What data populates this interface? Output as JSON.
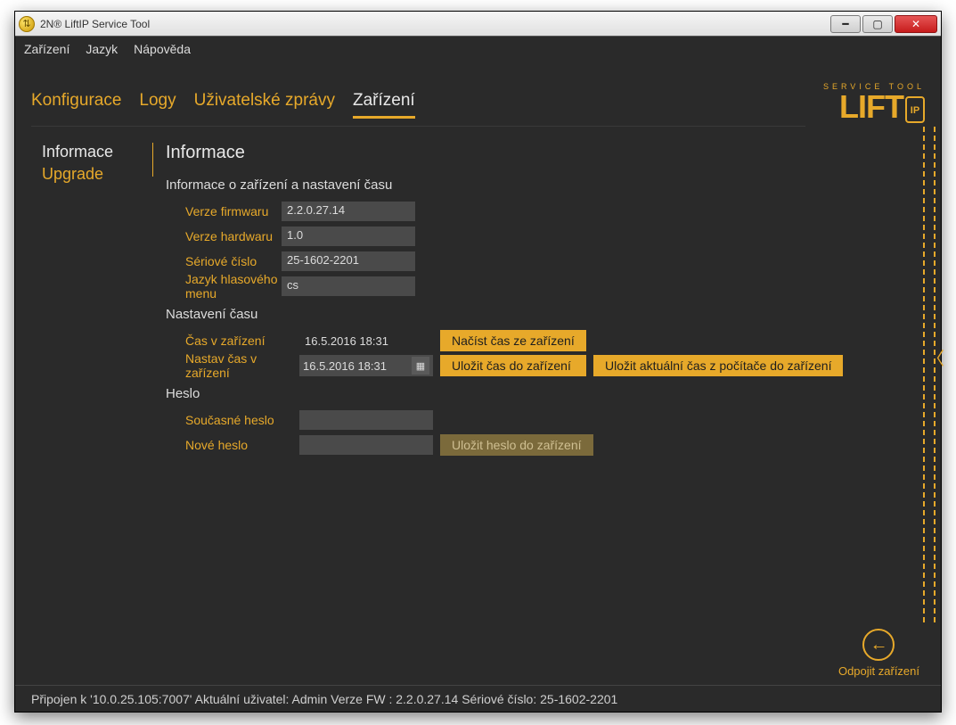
{
  "window": {
    "title": "2N® LiftIP Service Tool"
  },
  "menubar": {
    "items": [
      "Zařízení",
      "Jazyk",
      "Nápověda"
    ]
  },
  "tabs": {
    "items": [
      "Konfigurace",
      "Logy",
      "Uživatelské zprávy",
      "Zařízení"
    ],
    "active_index": 3
  },
  "logo": {
    "small": "SERVICE TOOL",
    "big": "LIFT"
  },
  "leftnav": {
    "items": [
      {
        "label": "Informace",
        "active": true
      },
      {
        "label": "Upgrade",
        "active": false
      }
    ]
  },
  "page": {
    "title": "Informace",
    "section1": {
      "heading": "Informace o zařízení a nastavení času",
      "rows": [
        {
          "label": "Verze firmwaru",
          "value": "2.2.0.27.14"
        },
        {
          "label": "Verze hardwaru",
          "value": "1.0"
        },
        {
          "label": "Sériové číslo",
          "value": "25-1602-2201"
        },
        {
          "label": "Jazyk hlasového menu",
          "value": "cs"
        }
      ]
    },
    "section2": {
      "heading": "Nastavení času",
      "device_time_label": "Čas v zařízení",
      "device_time_value": "16.5.2016 18:31",
      "set_time_label": "Nastav čas v zařízení",
      "set_time_value": "16.5.2016 18:31",
      "btn_read": "Načíst čas ze zařízení",
      "btn_save": "Uložit čas do zařízení",
      "btn_save_pc": "Uložit aktuální čas z počítače do zařízení"
    },
    "section3": {
      "heading": "Heslo",
      "cur_label": "Současné heslo",
      "new_label": "Nové heslo",
      "btn_save_pw": "Uložit heslo do zařízení"
    }
  },
  "disconnect": {
    "label": "Odpojit zařízení"
  },
  "statusbar": {
    "text": "Připojen k '10.0.25.105:7007'  Aktuální uživatel: Admin  Verze FW : 2.2.0.27.14  Sériové číslo: 25-1602-2201"
  }
}
